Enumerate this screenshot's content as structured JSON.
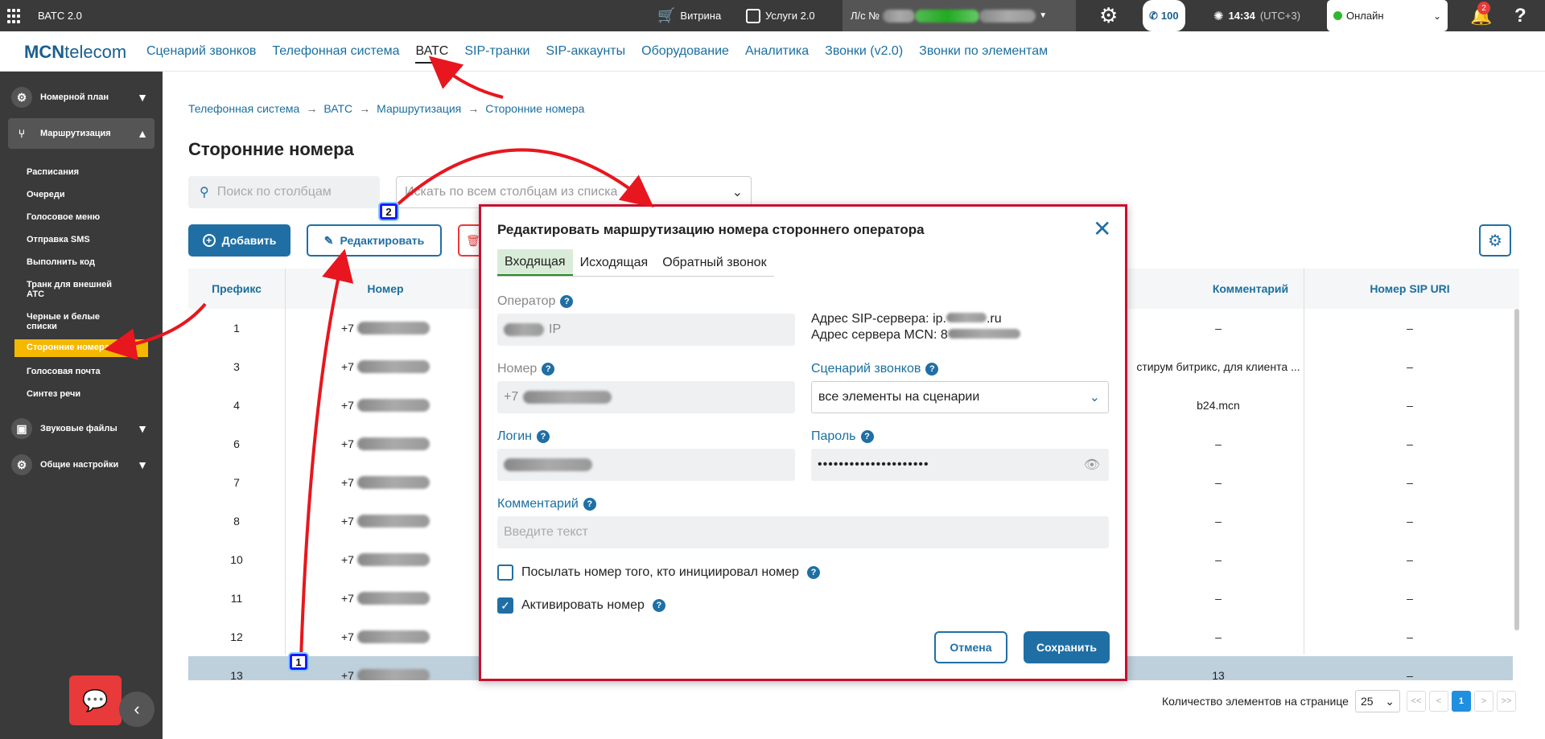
{
  "app": {
    "title": "ВАТС 2.0"
  },
  "topbar": {
    "vitrina": "Витрина",
    "services": "Услуги 2.0",
    "ls_label": "Л/с №",
    "calls_count": "100",
    "time": "14:34",
    "tz": "(UTC+3)",
    "status": "Онлайн",
    "notif_count": "2",
    "help": "?"
  },
  "navbar": {
    "logo_a": "MCN",
    "logo_b": "telecom",
    "items": [
      "Сценарий звонков",
      "Телефонная система",
      "ВАТС",
      "SIP-транки",
      "SIP-аккаунты",
      "Оборудование",
      "Аналитика",
      "Звонки (v2.0)",
      "Звонки по элементам"
    ]
  },
  "sidebar": {
    "groups": [
      "Номерной план",
      "Маршрутизация",
      "Звуковые файлы",
      "Общие настройки"
    ],
    "items": [
      "Расписания",
      "Очереди",
      "Голосовое меню",
      "Отправка SMS",
      "Выполнить код",
      "Транк для внешней АТС",
      "Черные и белые списки",
      "Сторонние номера",
      "Голосовая почта",
      "Синтез речи"
    ]
  },
  "breadcrumb": [
    "Телефонная система",
    "ВАТС",
    "Маршрутизация",
    "Сторонние номера"
  ],
  "page": {
    "title": "Сторонние номера",
    "search_placeholder": "Поиск по столбцам",
    "column_select_placeholder": "Искать по всем столбцам из списка",
    "add_label": "Добавить",
    "edit_label": "Редактировать"
  },
  "table": {
    "headers": {
      "prefix": "Префикс",
      "number": "Номер",
      "comment": "Комментарий",
      "sip_uri": "Номер SIP URI"
    },
    "rows": [
      {
        "prefix": "1",
        "number": "+7",
        "comment": "–",
        "sip": "–"
      },
      {
        "prefix": "3",
        "number": "+7",
        "comment": "стирум битрикс, для клиента ...",
        "sip": "–"
      },
      {
        "prefix": "4",
        "number": "+7",
        "comment": "b24.mcn",
        "sip": "–"
      },
      {
        "prefix": "6",
        "number": "+7",
        "comment": "–",
        "sip": "–"
      },
      {
        "prefix": "7",
        "number": "+7",
        "comment": "–",
        "sip": "–"
      },
      {
        "prefix": "8",
        "number": "+7",
        "comment": "–",
        "sip": "–"
      },
      {
        "prefix": "10",
        "number": "+7",
        "comment": "–",
        "sip": "–"
      },
      {
        "prefix": "11",
        "number": "+7",
        "comment": "–",
        "sip": "–"
      },
      {
        "prefix": "12",
        "number": "+7",
        "comment": "–",
        "sip": "–"
      },
      {
        "prefix": "13",
        "number": "+7",
        "comment": "13",
        "sip": "–"
      }
    ]
  },
  "pager": {
    "label": "Количество элементов на странице",
    "page_size": "25",
    "first": "<<",
    "prev": "<",
    "current": "1",
    "next": ">",
    "last": ">>"
  },
  "modal": {
    "title": "Редактировать маршрутизацию номера стороннего оператора",
    "tabs": [
      "Входящая",
      "Исходящая",
      "Обратный звонок"
    ],
    "operator_label": "Оператор",
    "operator_value": "IP",
    "sip_server_label": "Адрес SIP-сервера: ip.",
    "sip_server_suffix": ".ru",
    "mcn_server_label": "Адрес сервера MCN: 8",
    "number_label": "Номер",
    "number_value": "+7",
    "scenario_label": "Сценарий звонков",
    "scenario_value": "все элементы на сценарии",
    "login_label": "Логин",
    "password_label": "Пароль",
    "password_value": "•••••••••••••••••••••",
    "comment_label": "Комментарий",
    "comment_placeholder": "Введите текст",
    "send_initiator_label": "Посылать номер того, кто инициировал номер",
    "activate_label": "Активировать номер",
    "cancel_label": "Отмена",
    "save_label": "Сохранить"
  },
  "annotations": {
    "marker1": "1",
    "marker2": "2"
  }
}
